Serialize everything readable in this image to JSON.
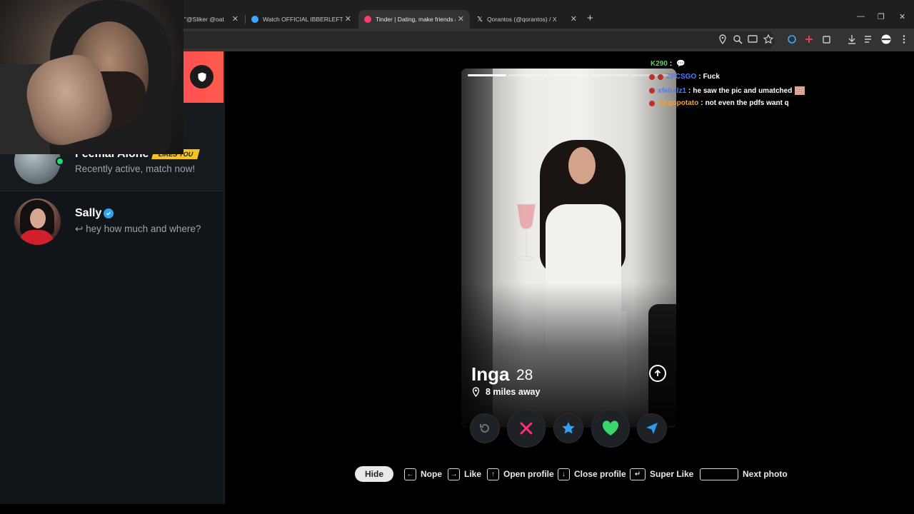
{
  "browser": {
    "tabs": [
      {
        "label": "\"@Sliker @oat",
        "favicon_color": "#333333",
        "active": false
      },
      {
        "label": "Watch OFFICIAL IBBERLEFT SO",
        "favicon_color": "#3ea6ff",
        "active": false
      },
      {
        "label": "Tinder | Dating, make friends &",
        "favicon_color": "#fd3a6b",
        "active": true
      },
      {
        "label": "Qorantos (@qorantos) / X",
        "favicon_color": "#ffffff",
        "active": false
      }
    ],
    "new_tab": "+",
    "window_controls": {
      "minimize": "—",
      "restore": "❐",
      "close": "✕"
    }
  },
  "sidebar": {
    "matches": [
      {
        "name": "Feemal Alone",
        "badge": "LIKES YOU",
        "subtitle": "Recently active, match now!",
        "online": true
      },
      {
        "name": "Sally",
        "verified": true,
        "subtitle": "hey how much and where?",
        "reply_icon": "↩"
      }
    ]
  },
  "profile": {
    "name": "Inga",
    "age": "28",
    "distance": "8 miles away",
    "photo_count": 5,
    "current_photo": 1
  },
  "actions": {
    "rewind": "rewind-icon",
    "nope": "x-icon",
    "super_like": "star-icon",
    "like": "heart-icon",
    "boost": "send-icon"
  },
  "chat": [
    {
      "user": "K290",
      "message": "",
      "color": "#5bd05b"
    },
    {
      "user": "ZPCSGO",
      "message": "Fuck",
      "color": "#4f7dff"
    },
    {
      "user": "xfelralz1",
      "message": "he saw the pic and umatched",
      "color": "#4f7dff"
    },
    {
      "user": "diegopotato",
      "message": "not even the pdfs want q",
      "color": "#e8a540"
    }
  ],
  "hints": {
    "hide": "Hide",
    "nope": "Nope",
    "like": "Like",
    "open_profile": "Open profile",
    "close_profile": "Close profile",
    "super_like": "Super Like",
    "next_photo": "Next photo"
  },
  "colors": {
    "tinder_gradient_start": "#fd2873",
    "tinder_gradient_end": "#ff5a4b",
    "nope": "#ff2d7a",
    "super_like": "#2fa3f1",
    "like": "#3bd66b",
    "boost": "#2a9cf0",
    "online": "#26d96c"
  }
}
